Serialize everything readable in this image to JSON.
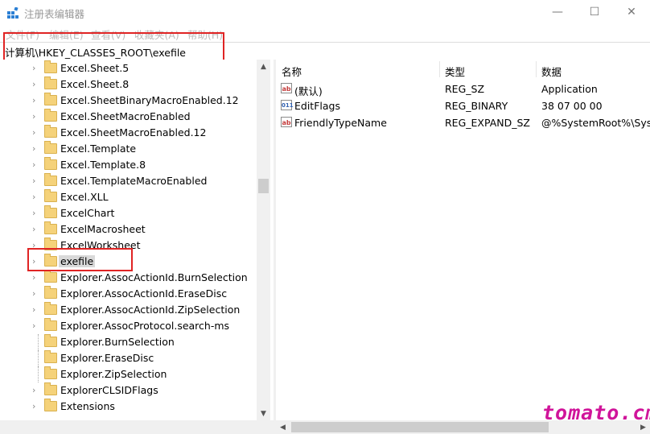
{
  "window": {
    "title": "注册表编辑器"
  },
  "window_controls": {
    "minimize": "—",
    "maximize": "☐",
    "close": "✕"
  },
  "menu": [
    "文件(F)",
    "编辑(E)",
    "查看(V)",
    "收藏夹(A)",
    "帮助(H)"
  ],
  "address": {
    "path": "计算机\\HKEY_CLASSES_ROOT\\exefile"
  },
  "tree": {
    "items": [
      "Excel.Sheet.5",
      "Excel.Sheet.8",
      "Excel.SheetBinaryMacroEnabled.12",
      "Excel.SheetMacroEnabled",
      "Excel.SheetMacroEnabled.12",
      "Excel.Template",
      "Excel.Template.8",
      "Excel.TemplateMacroEnabled",
      "Excel.XLL",
      "ExcelChart",
      "ExcelMacrosheet",
      "ExcelWorksheet",
      "exefile",
      "Explorer.AssocActionId.BurnSelection",
      "Explorer.AssocActionId.EraseDisc",
      "Explorer.AssocActionId.ZipSelection",
      "Explorer.AssocProtocol.search-ms",
      "Explorer.BurnSelection",
      "Explorer.EraseDisc",
      "Explorer.ZipSelection",
      "ExplorerCLSIDFlags",
      "Extensions"
    ],
    "selected": "exefile"
  },
  "list": {
    "headers": {
      "name": "名称",
      "type": "类型",
      "data": "数据"
    },
    "rows": [
      {
        "name": "(默认)",
        "type": "REG_SZ",
        "data": "Application",
        "icon": "string-value-icon"
      },
      {
        "name": "EditFlags",
        "type": "REG_BINARY",
        "data": "38 07 00 00",
        "icon": "binary-value-icon"
      },
      {
        "name": "FriendlyTypeName",
        "type": "REG_EXPAND_SZ",
        "data": "@%SystemRoot%\\Syst",
        "icon": "string-value-icon"
      }
    ]
  },
  "icons": {
    "string": "ab",
    "binary": "011"
  },
  "watermark": "tomato.cm",
  "colors": {
    "highlight": "#e02424",
    "watermark": "#d0149a",
    "folder": "#f5d27a"
  }
}
